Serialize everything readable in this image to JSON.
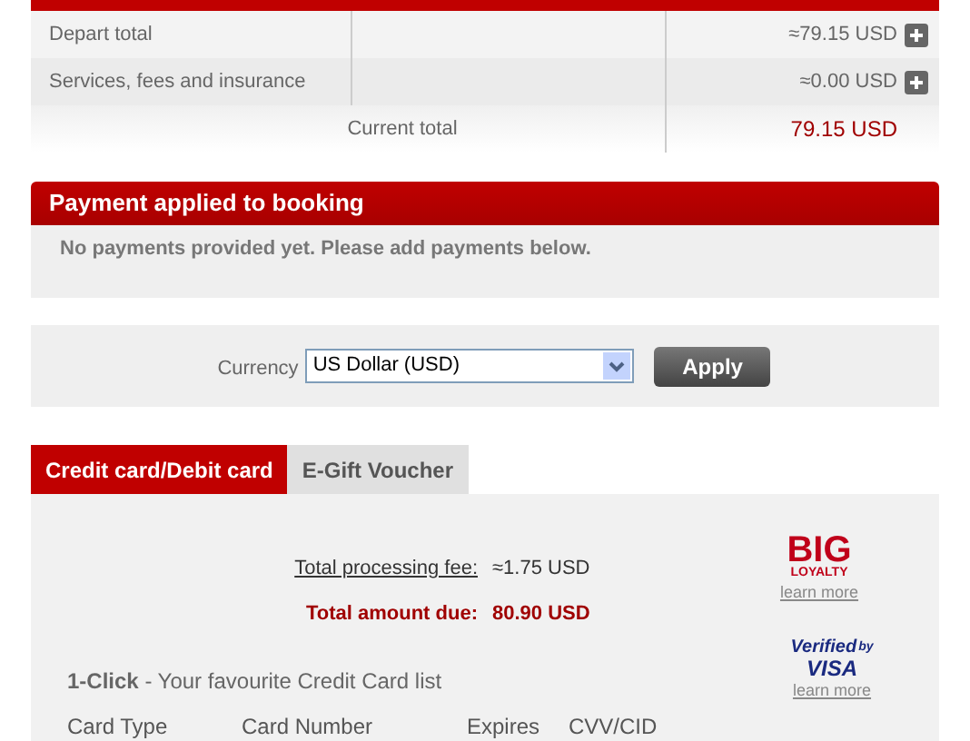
{
  "summary": {
    "rows": [
      {
        "label": "Depart total",
        "amount": "≈79.15 USD",
        "expandable": true
      },
      {
        "label": "Services, fees and insurance",
        "amount": "≈0.00 USD",
        "expandable": true
      }
    ],
    "total": {
      "label": "Current total",
      "amount": "79.15 USD"
    }
  },
  "payment_applied": {
    "title": "Payment applied to booking",
    "message": "No payments provided yet. Please add payments below."
  },
  "currency": {
    "label": "Currency",
    "value": "US Dollar (USD)",
    "button": "Apply"
  },
  "tabs": [
    {
      "label": "Credit card/Debit card",
      "selected": true
    },
    {
      "label": "E-Gift Voucher",
      "selected": false
    }
  ],
  "fees": {
    "processing_label": "Total processing fee:",
    "processing_value": "≈1.75 USD",
    "due_label": "Total amount due:",
    "due_value": "80.90 USD"
  },
  "big_loyalty": {
    "title": "BIG",
    "subtitle": "LOYALTY",
    "link": "learn more"
  },
  "verified_visa": {
    "title": "Verified",
    "by": "by",
    "brand": "VISA",
    "link": "learn more"
  },
  "one_click": "**1-Click** - Your favourite Credit Card list",
  "card_columns": [
    "Card Type",
    "Card Number",
    "Expires",
    "CVV/CID"
  ]
}
